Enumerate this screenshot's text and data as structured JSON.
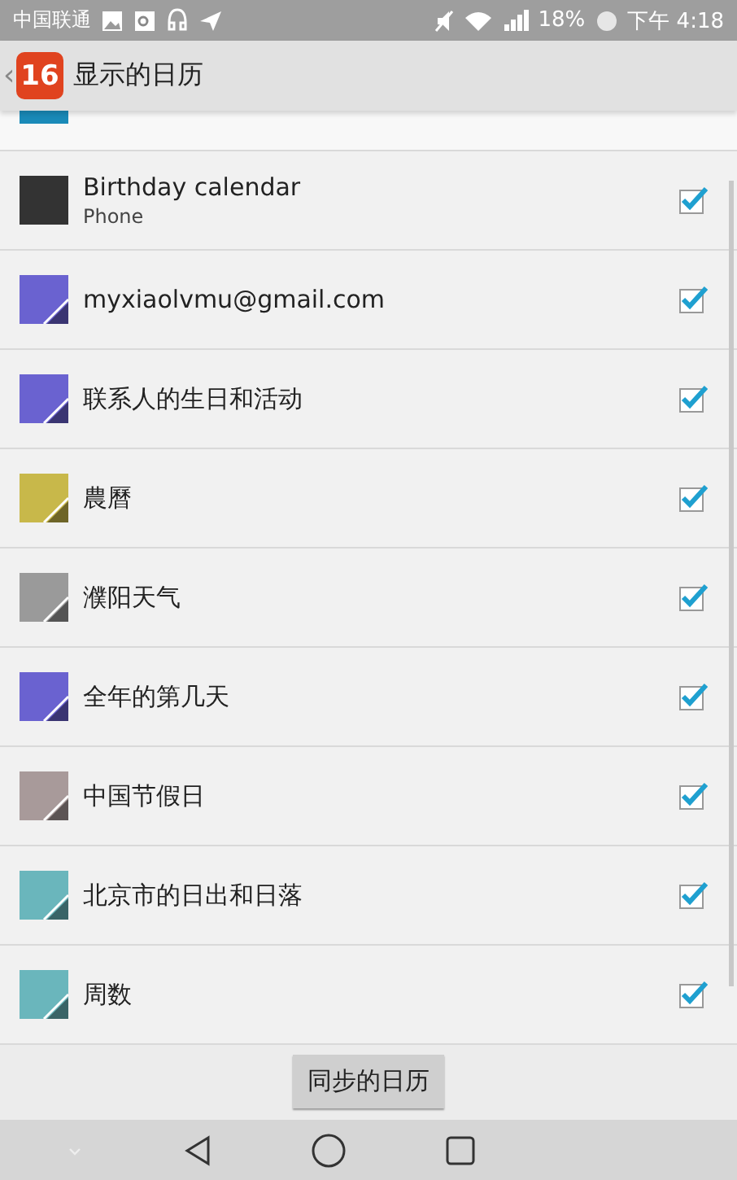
{
  "status_bar": {
    "carrier": "中国联通",
    "battery": "18%",
    "time": "下午 4:18"
  },
  "header": {
    "back": "‹",
    "app_icon": "16",
    "title": "显示的日历"
  },
  "partial_row": {
    "color": "#1a8ab8"
  },
  "calendars": [
    {
      "name": "Birthday calendar",
      "account": "Phone",
      "color": "#333333",
      "corner": false,
      "checked": true
    },
    {
      "name": "myxiaolvmu@gmail.com",
      "color": "#6a62d0",
      "corner": true,
      "checked": true
    },
    {
      "name": "联系人的生日和活动",
      "color": "#6a62d0",
      "corner": true,
      "checked": true
    },
    {
      "name": "農曆",
      "color": "#c8b84a",
      "corner": true,
      "checked": true
    },
    {
      "name": "濮阳天气",
      "color": "#9a9a9a",
      "corner": true,
      "checked": true
    },
    {
      "name": "全年的第几天",
      "color": "#6a62d0",
      "corner": true,
      "checked": true
    },
    {
      "name": "中国节假日",
      "color": "#a89a9a",
      "corner": true,
      "checked": true
    },
    {
      "name": "北京市的日出和日落",
      "color": "#6ab6bc",
      "corner": true,
      "checked": true
    },
    {
      "name": "周数",
      "color": "#6ab6bc",
      "corner": true,
      "checked": true
    }
  ],
  "sync_button": "同步的日历"
}
